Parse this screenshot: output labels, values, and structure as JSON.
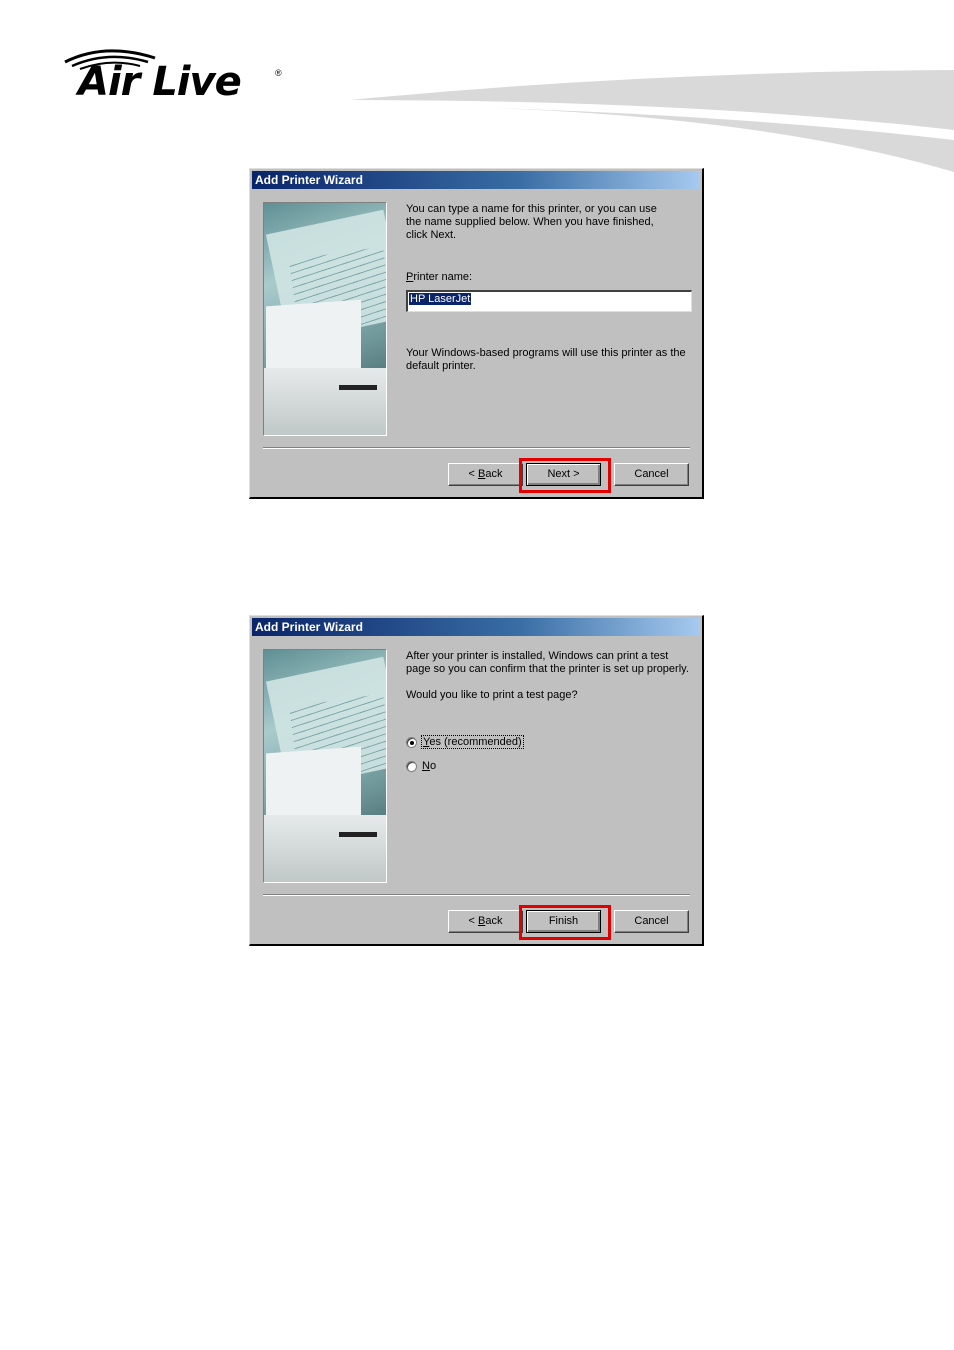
{
  "brand": {
    "logo_text": "Air Live",
    "registered_mark": "®",
    "logo_icon": "wireless-waves-icon"
  },
  "dialogs": [
    {
      "title": "Add Printer Wizard",
      "intro": "You can type a name for this printer, or you can use the name supplied below. When you have finished, click Next.",
      "intro_lines": [
        "You can type a name for this printer, or you can use",
        "the name supplied below. When you have finished,",
        "click Next."
      ],
      "field_label_mnemonic": "P",
      "field_label_rest": "rinter name:",
      "field_value": "HP LaserJet",
      "note_lines": [
        "Your Windows-based programs will use this printer as the",
        "default printer."
      ],
      "buttons": {
        "back": "< Back",
        "back_mnemonic": "B",
        "next": "Next >",
        "cancel": "Cancel"
      },
      "highlighted_button": "next",
      "side_image": "printer-illustration"
    },
    {
      "title": "Add Printer Wizard",
      "intro_lines": [
        "After your printer is installed, Windows can print a test",
        "page so you can confirm that the printer is set up properly."
      ],
      "question": "Would you like to print a test page?",
      "options": [
        {
          "mnemonic": "Y",
          "rest": "es (recommended)",
          "selected": true
        },
        {
          "mnemonic": "N",
          "rest": "o",
          "selected": false
        }
      ],
      "buttons": {
        "back": "< Back",
        "back_mnemonic": "B",
        "next": "Finish",
        "cancel": "Cancel"
      },
      "highlighted_button": "finish",
      "side_image": "printer-illustration"
    }
  ],
  "colors": {
    "highlight_box": "#e20000",
    "dialog_face": "#c0c0c0",
    "titlebar_start": "#0a246a",
    "titlebar_end": "#a6caf0",
    "swoosh": "#d9d9d9"
  }
}
